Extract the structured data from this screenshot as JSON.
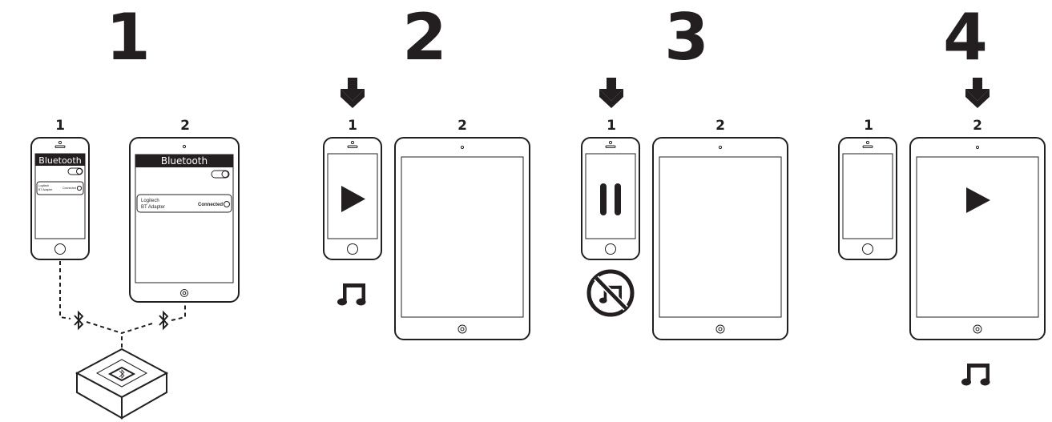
{
  "colors": {
    "ink": "#231f20",
    "background": "#ffffff"
  },
  "steps": [
    {
      "number": "1",
      "phone_label": "1",
      "tablet_label": "2",
      "phone_screen": {
        "title": "Bluetooth",
        "device_line1": "Logitech",
        "device_line2": "BT Adapter",
        "status": "Connected"
      },
      "tablet_screen": {
        "title": "Bluetooth",
        "device_line1": "Logitech",
        "device_line2": "BT Adapter",
        "status": "Connected"
      },
      "icons": [
        "bluetooth-icon",
        "bluetooth-icon",
        "bluetooth-adapter-icon",
        "toggle-icon",
        "info-icon"
      ]
    },
    {
      "number": "2",
      "phone_label": "1",
      "tablet_label": "2",
      "active_device": "1",
      "phone_icon": "play-icon",
      "audio_icon": "music-note-icon"
    },
    {
      "number": "3",
      "phone_label": "1",
      "tablet_label": "2",
      "active_device": "1",
      "phone_icon": "pause-icon",
      "audio_icon": "no-music-icon"
    },
    {
      "number": "4",
      "phone_label": "1",
      "tablet_label": "2",
      "active_device": "2",
      "tablet_icon": "play-icon",
      "audio_icon": "music-note-icon"
    }
  ]
}
